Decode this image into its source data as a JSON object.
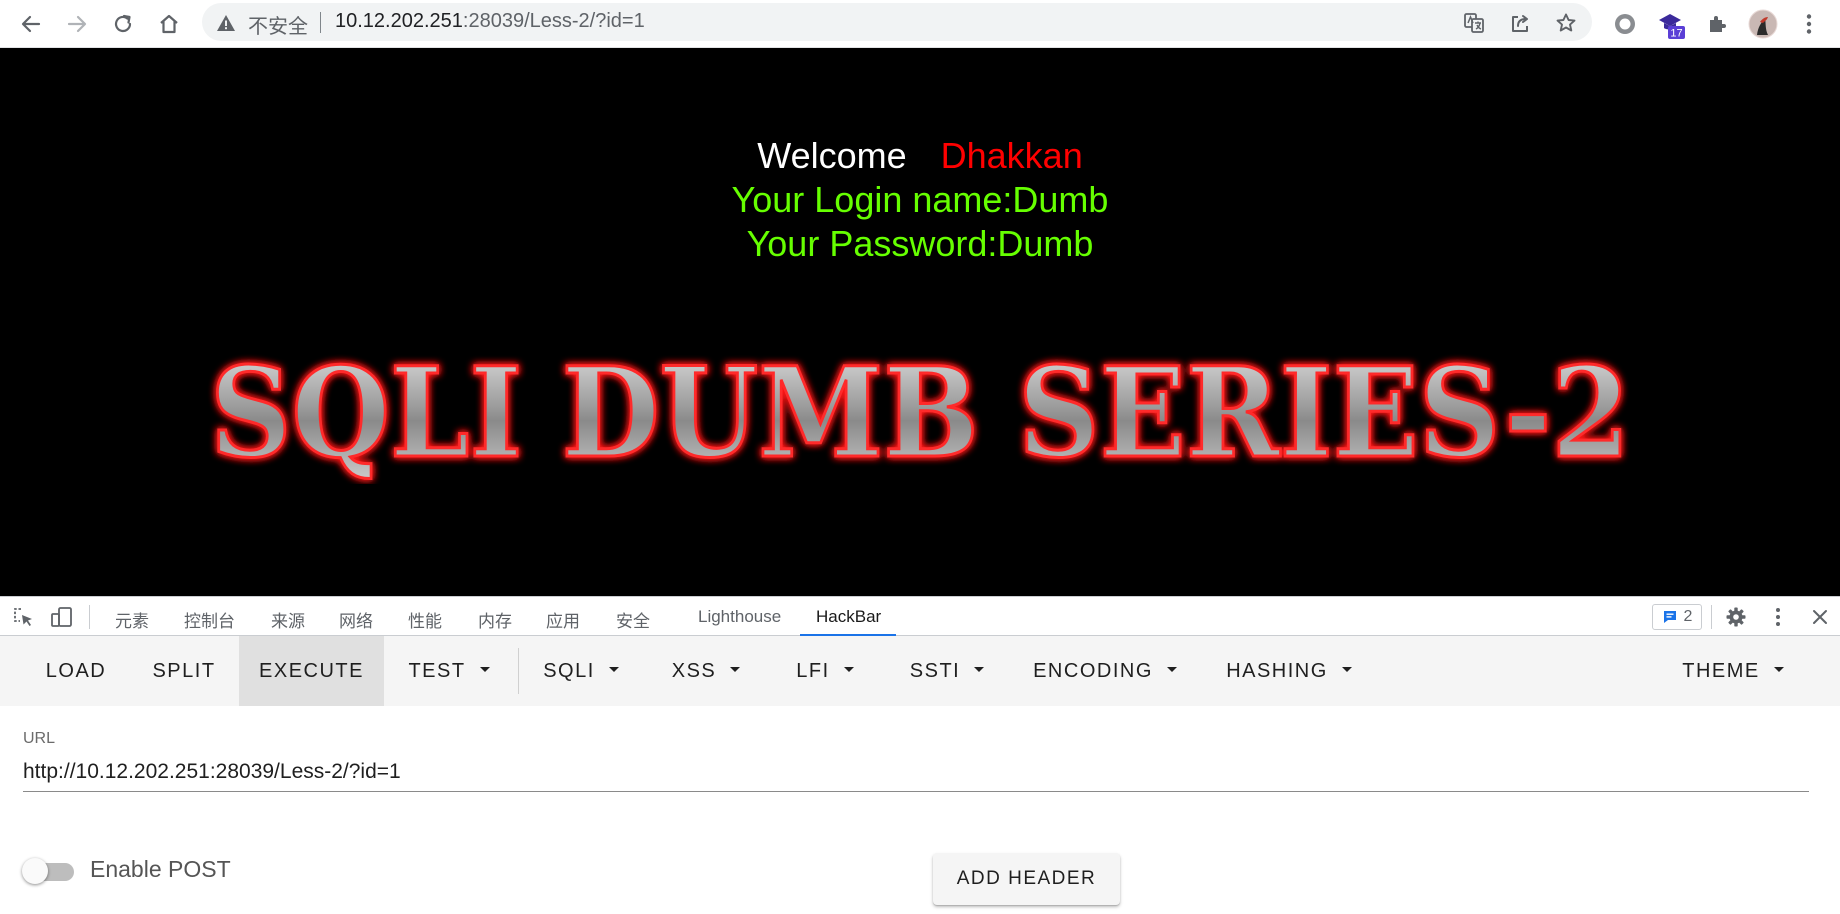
{
  "browser": {
    "security_label": "不安全",
    "url_host": "10.12.202.251",
    "url_rest": ":28039/Less-2/?id=1",
    "extension_badge": "17",
    "icons": [
      "back-icon",
      "forward-icon",
      "reload-icon",
      "home-icon",
      "warning-icon",
      "translate-icon",
      "share-icon",
      "bookmark-star-icon",
      "circle-extension-icon",
      "hat-extension-icon",
      "puzzle-icon",
      "profile-avatar",
      "kebab-menu-icon"
    ]
  },
  "page": {
    "welcome": "Welcome",
    "user": "Dhakkan",
    "login_name": "Your Login name:Dumb",
    "password": "Your Password:Dumb",
    "banner_text": "SQLI DUMB SERIES-2",
    "colors": {
      "background": "#000000",
      "welcome": "#ffffff",
      "user": "#ff0000",
      "info": "#66ff00"
    }
  },
  "devtools": {
    "tabs": [
      {
        "label": "元素"
      },
      {
        "label": "控制台"
      },
      {
        "label": "来源"
      },
      {
        "label": "网络"
      },
      {
        "label": "性能"
      },
      {
        "label": "内存"
      },
      {
        "label": "应用"
      },
      {
        "label": "安全"
      },
      {
        "label": "Lighthouse"
      },
      {
        "label": "HackBar"
      }
    ],
    "active_tab": "HackBar",
    "issues_count": "2",
    "accent": "#1a73e8"
  },
  "hackbar": {
    "menu": {
      "load": "LOAD",
      "split": "SPLIT",
      "execute": "EXECUTE",
      "test": "TEST",
      "sqli": "SQLI",
      "xss": "XSS",
      "lfi": "LFI",
      "ssti": "SSTI",
      "encoding": "ENCODING",
      "hashing": "HASHING",
      "theme": "THEME"
    },
    "url_label": "URL",
    "url_value": "http://10.12.202.251:28039/Less-2/?id=1",
    "enable_post_label": "Enable POST",
    "enable_post": false,
    "add_header_label": "ADD HEADER"
  }
}
